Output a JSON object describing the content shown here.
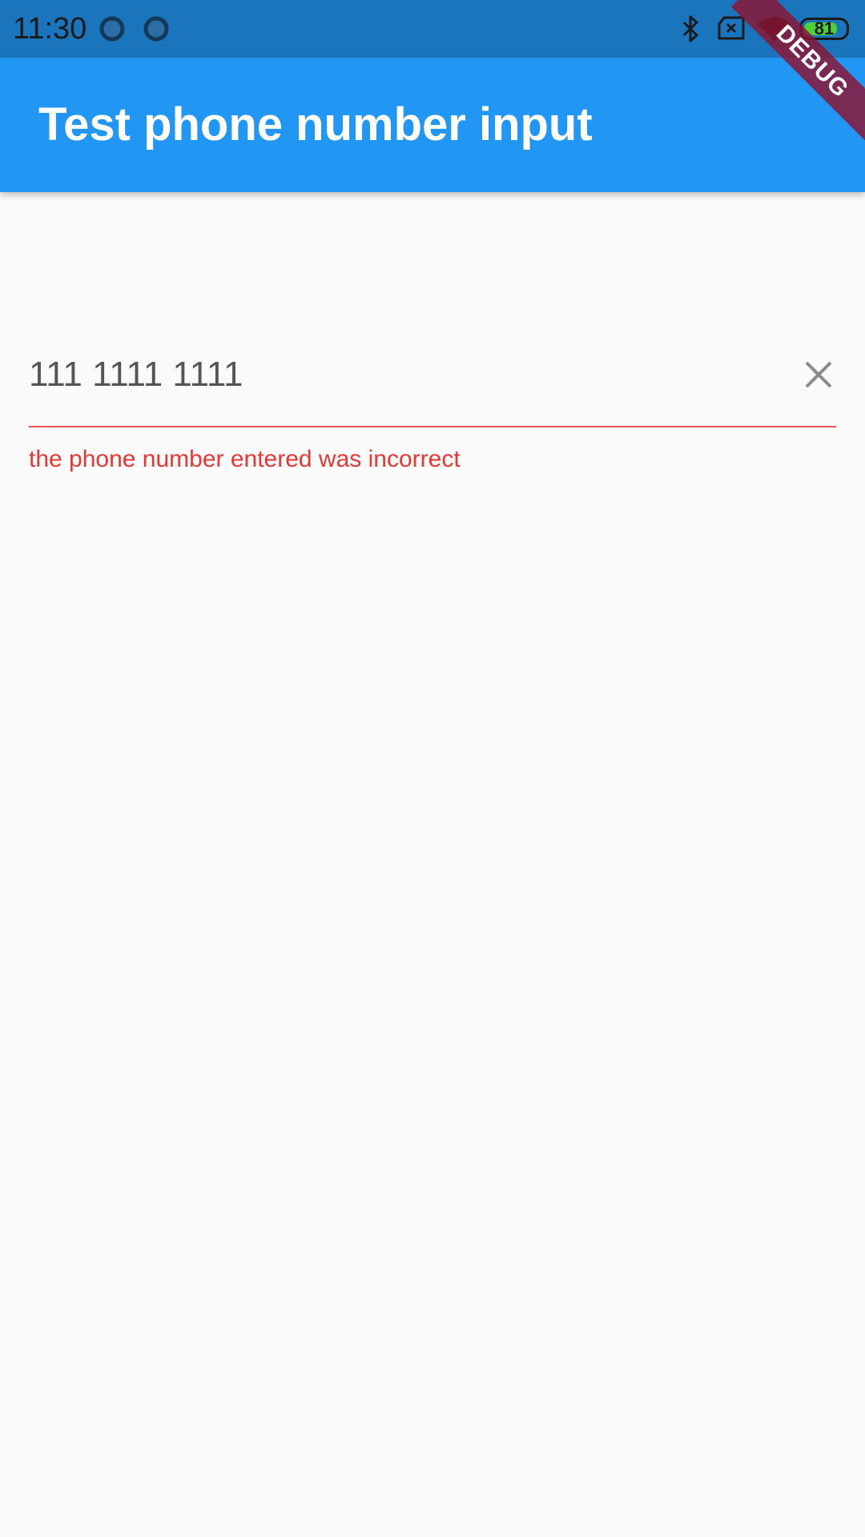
{
  "status_bar": {
    "time": "11:30",
    "battery_level": "81",
    "battery_fraction": 0.81,
    "icons": [
      "notification-dot-icon",
      "notification-dot-icon",
      "bluetooth-icon",
      "no-sim-icon",
      "wifi-icon",
      "battery-icon"
    ]
  },
  "app_bar": {
    "title": "Test phone number input",
    "background_color": "#2196f3"
  },
  "debug_banner": {
    "label": "DEBUG"
  },
  "phone_field": {
    "value": "111 1111 1111",
    "placeholder": "",
    "clear_icon": "close-icon",
    "error_text": "the phone number entered was incorrect",
    "error_color": "#e53935"
  }
}
